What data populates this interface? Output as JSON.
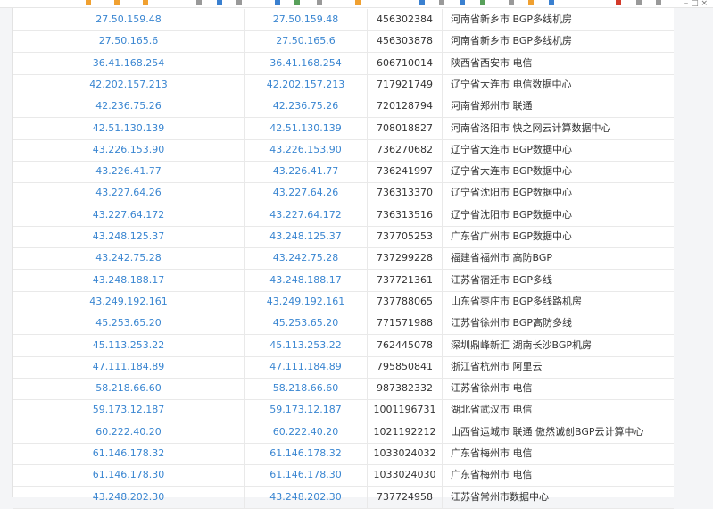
{
  "toolbar": {
    "icons": [
      "folder-icon",
      "folder-icon",
      "folder-icon",
      "file-icon",
      "file-icon",
      "file-icon",
      "file-icon",
      "file-icon",
      "file-icon",
      "file-icon",
      "file-icon",
      "file-icon",
      "file-icon",
      "file-icon",
      "file-icon",
      "file-icon",
      "file-icon",
      "file-icon",
      "file-icon",
      "file-icon"
    ],
    "window_controls": "– □ ×"
  },
  "table": {
    "rows": [
      {
        "ip": "27.50.159.48",
        "ip_link": "27.50.159.48",
        "id": "456302384",
        "location": "河南省新乡市 BGP多线机房"
      },
      {
        "ip": "27.50.165.6",
        "ip_link": "27.50.165.6",
        "id": "456303878",
        "location": "河南省新乡市 BGP多线机房"
      },
      {
        "ip": "36.41.168.254",
        "ip_link": "36.41.168.254",
        "id": "606710014",
        "location": "陕西省西安市 电信"
      },
      {
        "ip": "42.202.157.213",
        "ip_link": "42.202.157.213",
        "id": "717921749",
        "location": "辽宁省大连市 电信数据中心"
      },
      {
        "ip": "42.236.75.26",
        "ip_link": "42.236.75.26",
        "id": "720128794",
        "location": "河南省郑州市 联通"
      },
      {
        "ip": "42.51.130.139",
        "ip_link": "42.51.130.139",
        "id": "708018827",
        "location": "河南省洛阳市 快之网云计算数据中心"
      },
      {
        "ip": "43.226.153.90",
        "ip_link": "43.226.153.90",
        "id": "736270682",
        "location": "辽宁省大连市 BGP数据中心"
      },
      {
        "ip": "43.226.41.77",
        "ip_link": "43.226.41.77",
        "id": "736241997",
        "location": "辽宁省大连市 BGP数据中心"
      },
      {
        "ip": "43.227.64.26",
        "ip_link": "43.227.64.26",
        "id": "736313370",
        "location": "辽宁省沈阳市 BGP数据中心"
      },
      {
        "ip": "43.227.64.172",
        "ip_link": "43.227.64.172",
        "id": "736313516",
        "location": "辽宁省沈阳市 BGP数据中心"
      },
      {
        "ip": "43.248.125.37",
        "ip_link": "43.248.125.37",
        "id": "737705253",
        "location": "广东省广州市 BGP数据中心"
      },
      {
        "ip": "43.242.75.28",
        "ip_link": "43.242.75.28",
        "id": "737299228",
        "location": "福建省福州市 高防BGP"
      },
      {
        "ip": "43.248.188.17",
        "ip_link": "43.248.188.17",
        "id": "737721361",
        "location": "江苏省宿迁市 BGP多线"
      },
      {
        "ip": "43.249.192.161",
        "ip_link": "43.249.192.161",
        "id": "737788065",
        "location": "山东省枣庄市 BGP多线路机房"
      },
      {
        "ip": "45.253.65.20",
        "ip_link": "45.253.65.20",
        "id": "771571988",
        "location": "江苏省徐州市 BGP高防多线"
      },
      {
        "ip": "45.113.253.22",
        "ip_link": "45.113.253.22",
        "id": "762445078",
        "location": "深圳鼎峰新汇 湖南长沙BGP机房"
      },
      {
        "ip": "47.111.184.89",
        "ip_link": "47.111.184.89",
        "id": "795850841",
        "location": "浙江省杭州市 阿里云"
      },
      {
        "ip": "58.218.66.60",
        "ip_link": "58.218.66.60",
        "id": "987382332",
        "location": "江苏省徐州市 电信"
      },
      {
        "ip": "59.173.12.187",
        "ip_link": "59.173.12.187",
        "id": "1001196731",
        "location": "湖北省武汉市 电信"
      },
      {
        "ip": "60.222.40.20",
        "ip_link": "60.222.40.20",
        "id": "1021192212",
        "location": "山西省运城市 联通 傲然诚创BGP云计算中心"
      },
      {
        "ip": "61.146.178.32",
        "ip_link": "61.146.178.32",
        "id": "1033024032",
        "location": "广东省梅州市 电信"
      },
      {
        "ip": "61.146.178.30",
        "ip_link": "61.146.178.30",
        "id": "1033024030",
        "location": "广东省梅州市 电信"
      },
      {
        "ip": "43.248.202.30",
        "ip_link": "43.248.202.30",
        "id": "737724958",
        "location": "江苏省常州市数据中心"
      }
    ]
  }
}
